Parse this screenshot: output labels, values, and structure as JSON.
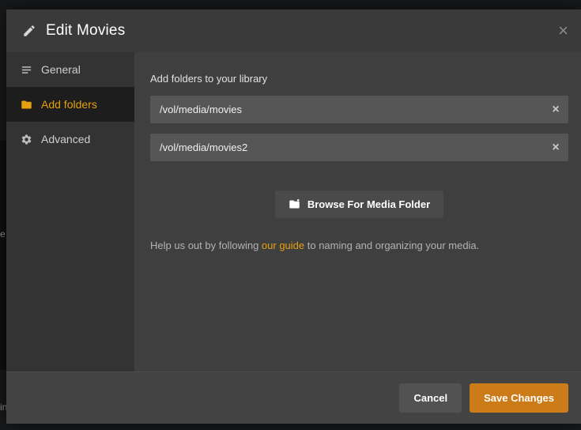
{
  "background": {
    "fragment_left": "e",
    "fragment_bottom": "in"
  },
  "modal": {
    "title": "Edit Movies",
    "close_glyph": "×"
  },
  "sidebar": {
    "items": [
      {
        "label": "General",
        "icon": "list-icon",
        "active": false
      },
      {
        "label": "Add folders",
        "icon": "folder-icon",
        "active": true
      },
      {
        "label": "Advanced",
        "icon": "gear-icon",
        "active": false
      }
    ]
  },
  "content": {
    "section_label": "Add folders to your library",
    "folders": [
      {
        "value": "/vol/media/movies"
      },
      {
        "value": "/vol/media/movies2"
      }
    ],
    "clear_glyph": "×",
    "browse_button_label": "Browse For Media Folder",
    "help_prefix": "Help us out by following ",
    "help_link_text": "our guide",
    "help_suffix": " to naming and organizing your media."
  },
  "footer": {
    "cancel_label": "Cancel",
    "save_label": "Save Changes"
  },
  "colors": {
    "accent_orange": "#cc7b19",
    "link_orange": "#e5a00d",
    "modal_bg": "#3f3f3f",
    "sidebar_bg": "#333333",
    "active_item_bg": "#1d1d1d",
    "input_bg": "#565656"
  }
}
